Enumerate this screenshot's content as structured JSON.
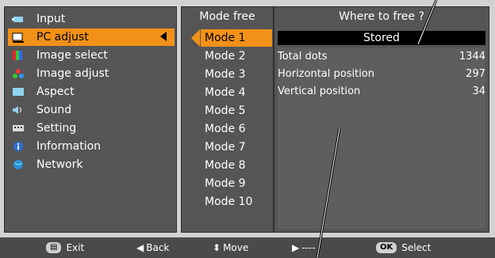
{
  "menu": {
    "items": [
      {
        "label": "Input",
        "icon": "input-icon"
      },
      {
        "label": "PC adjust",
        "icon": "pc-adjust-icon",
        "selected": true
      },
      {
        "label": "Image select",
        "icon": "image-select-icon"
      },
      {
        "label": "Image adjust",
        "icon": "image-adjust-icon"
      },
      {
        "label": "Aspect",
        "icon": "aspect-icon"
      },
      {
        "label": "Sound",
        "icon": "sound-icon"
      },
      {
        "label": "Setting",
        "icon": "setting-icon"
      },
      {
        "label": "Information",
        "icon": "information-icon"
      },
      {
        "label": "Network",
        "icon": "network-icon"
      }
    ]
  },
  "modes": {
    "header": "Mode free",
    "items": [
      "Mode 1",
      "Mode 2",
      "Mode 3",
      "Mode 4",
      "Mode 5",
      "Mode 6",
      "Mode 7",
      "Mode 8",
      "Mode 9",
      "Mode 10"
    ],
    "selected_index": 0
  },
  "info": {
    "header": "Where to free ?",
    "status": "Stored",
    "rows": [
      {
        "label": "Total dots",
        "value": "1344"
      },
      {
        "label": "Horizontal position",
        "value": "297"
      },
      {
        "label": "Vertical position",
        "value": "34"
      }
    ]
  },
  "bottom_bar": {
    "exit_label": "Exit",
    "back_label": "Back",
    "move_label": "Move",
    "next_label": "----",
    "select_key": "OK",
    "select_label": "Select"
  },
  "colors": {
    "panel_bg": "#555555",
    "highlight": "#f29118",
    "screen_bg": "#d2d2d2",
    "bar_bg": "#4a4a4a"
  }
}
